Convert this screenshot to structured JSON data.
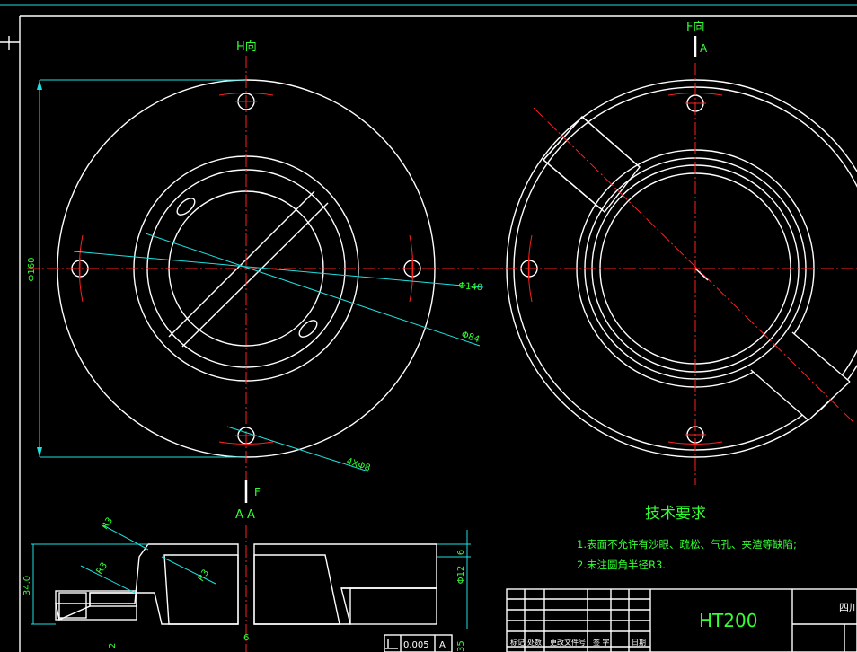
{
  "view_labels": {
    "h_view": "H向",
    "f_view": "F向",
    "f_marker_top": "A",
    "f_marker_bottom": "F",
    "section": "A-A"
  },
  "dimensions": {
    "d160": "Φ160",
    "d140": "Φ140",
    "d84": "Φ84",
    "holes": "4XΦ8",
    "r3_a": "R3",
    "r3_b": "R3",
    "r3_c": "R3",
    "h34": "34.0",
    "t6": "6",
    "d12": "Φ12",
    "bottom_6": "6",
    "bottom_2": "2",
    "right_35": "35"
  },
  "tech_req": {
    "title": "技术要求",
    "line1": "1.表面不允许有沙眼、疏松、气孔、夹渣等缺陷;",
    "line2": "2.未注圆角半径R3."
  },
  "gdt": {
    "tolerance": "0.005",
    "datum": "A"
  },
  "title_block": {
    "material": "HT200",
    "school_partial": "四川",
    "row_labels": [
      "标记",
      "处数",
      "更改文件号",
      "签 字",
      "日期"
    ]
  },
  "colors": {
    "background": "#000000",
    "outline": "#ffffff",
    "centerline": "#ff2020",
    "dimension": "#20e0e0",
    "text": "#33ff33"
  }
}
